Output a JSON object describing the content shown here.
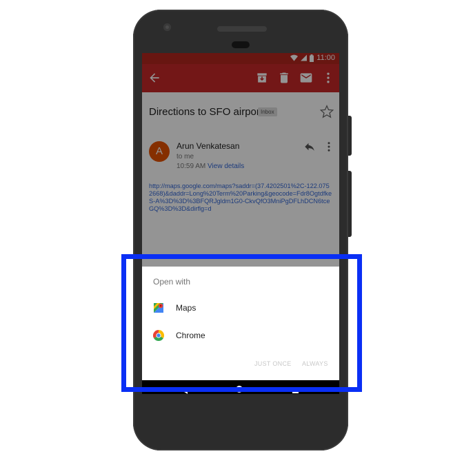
{
  "status_bar": {
    "time": "11:00",
    "icons": [
      "wifi-icon",
      "signal-icon",
      "battery-icon"
    ]
  },
  "toolbar": {
    "icons": [
      "back-arrow-icon",
      "archive-icon",
      "delete-icon",
      "mail-icon",
      "more-vert-icon"
    ]
  },
  "email": {
    "subject": "Directions to SFO airport",
    "label": "Inbox",
    "sender_initial": "A",
    "sender": "Arun Venkatesan",
    "recipient": "to me",
    "time": "10:59 AM",
    "view_details": "View details",
    "body_link": "http://maps.google.com/maps?saddr=(37.4202501%2C-122.0752668)&daddr=Long%20Term%20Parking&geocode=Fdr8OgtdfkeS-A%3D%3D%3BFQRJgldm1G0-CkvQfO3MniPgDFLhDCN6tceGQ%3D%3D&dirflg=d"
  },
  "chooser": {
    "title": "Open with",
    "apps": [
      {
        "label": "Maps",
        "icon": "maps-icon"
      },
      {
        "label": "Chrome",
        "icon": "chrome-icon"
      }
    ],
    "just_once": "JUST ONCE",
    "always": "ALWAYS"
  },
  "colors": {
    "accent_red": "#c62828",
    "link_blue": "#3367d6",
    "highlight_blue": "#0a2ff5"
  }
}
